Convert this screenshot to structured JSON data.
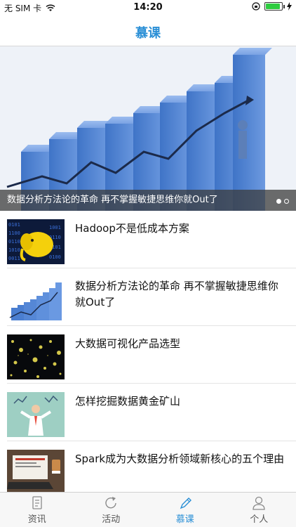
{
  "status": {
    "carrier": "无 SIM 卡",
    "time": "14:20"
  },
  "nav": {
    "title": "慕课"
  },
  "banner": {
    "caption": "数据分析方法论的革命 再不掌握敏捷思维你就Out了",
    "page_count": 2,
    "active_page": 1
  },
  "articles": [
    {
      "title": "Hadoop不是低成本方案",
      "thumb": "hadoop-elephant"
    },
    {
      "title": "数据分析方法论的革命 再不掌握敏捷思维你就Out了",
      "thumb": "bar-chart"
    },
    {
      "title": "大数据可视化产品选型",
      "thumb": "dark-dots"
    },
    {
      "title": "怎样挖掘数据黄金矿山",
      "thumb": "person-chart"
    },
    {
      "title": "Spark成为大数据分析领域新核心的五个理由",
      "thumb": "laptop-desk"
    }
  ],
  "tabs": [
    {
      "label": "资讯",
      "icon": "document-icon",
      "active": false
    },
    {
      "label": "活动",
      "icon": "refresh-icon",
      "active": false
    },
    {
      "label": "慕课",
      "icon": "pencil-icon",
      "active": true
    },
    {
      "label": "个人",
      "icon": "person-icon",
      "active": false
    }
  ],
  "colors": {
    "accent": "#2a8fd6",
    "battery": "#2ecc40"
  }
}
